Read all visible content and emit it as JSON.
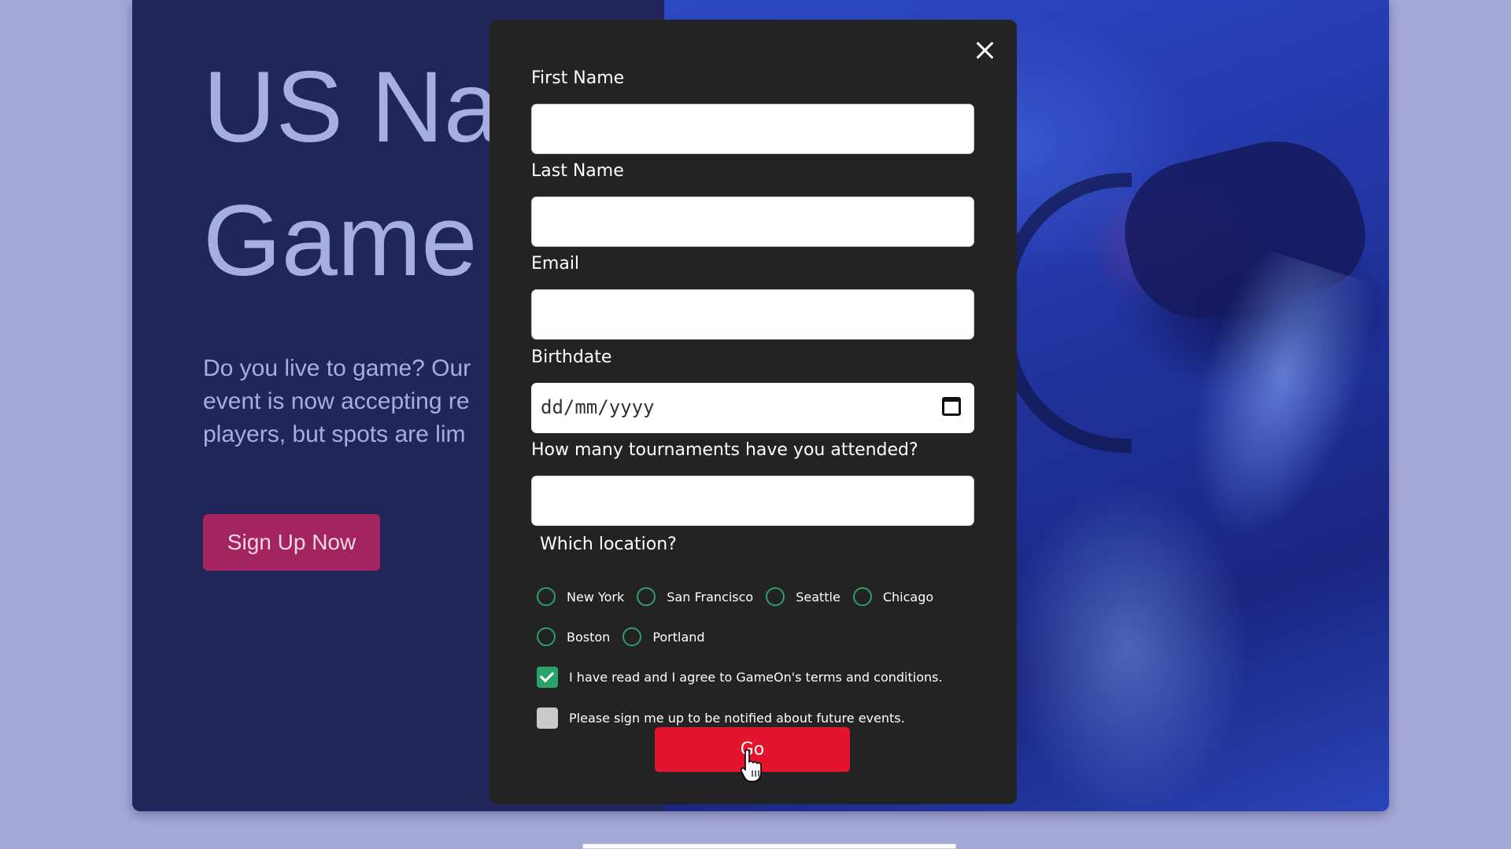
{
  "hero": {
    "title": "US Nat\nGame",
    "description": "Do you live to game? Our\nevent is now accepting re\nplayers, but spots are lim",
    "signup_label": "Sign Up Now"
  },
  "modal": {
    "fields": {
      "first_name_label": "First Name",
      "last_name_label": "Last Name",
      "email_label": "Email",
      "birthdate_label": "Birthdate",
      "birthdate_placeholder": "dd/mm/yyyy",
      "tournaments_label": "How many tournaments have you attended?"
    },
    "location": {
      "question": "Which location?",
      "options": [
        "New York",
        "San Francisco",
        "Seattle",
        "Chicago",
        "Boston",
        "Portland"
      ]
    },
    "checkboxes": {
      "terms_label": "I have read and I agree to GameOn's terms and conditions.",
      "terms_checked": true,
      "notify_label": "Please sign me up to be notified about future events.",
      "notify_checked": false
    },
    "submit_label": "Go"
  },
  "colors": {
    "page_background": "#a4a8d6",
    "hero_background": "#20265a",
    "signup_button": "#a3245f",
    "modal_background": "#232323",
    "radio_accent": "#2e9e6a",
    "submit_button": "#e3142e"
  },
  "icons": [
    "close-icon",
    "calendar-icon",
    "checkmark-icon",
    "pointer-cursor-icon"
  ]
}
